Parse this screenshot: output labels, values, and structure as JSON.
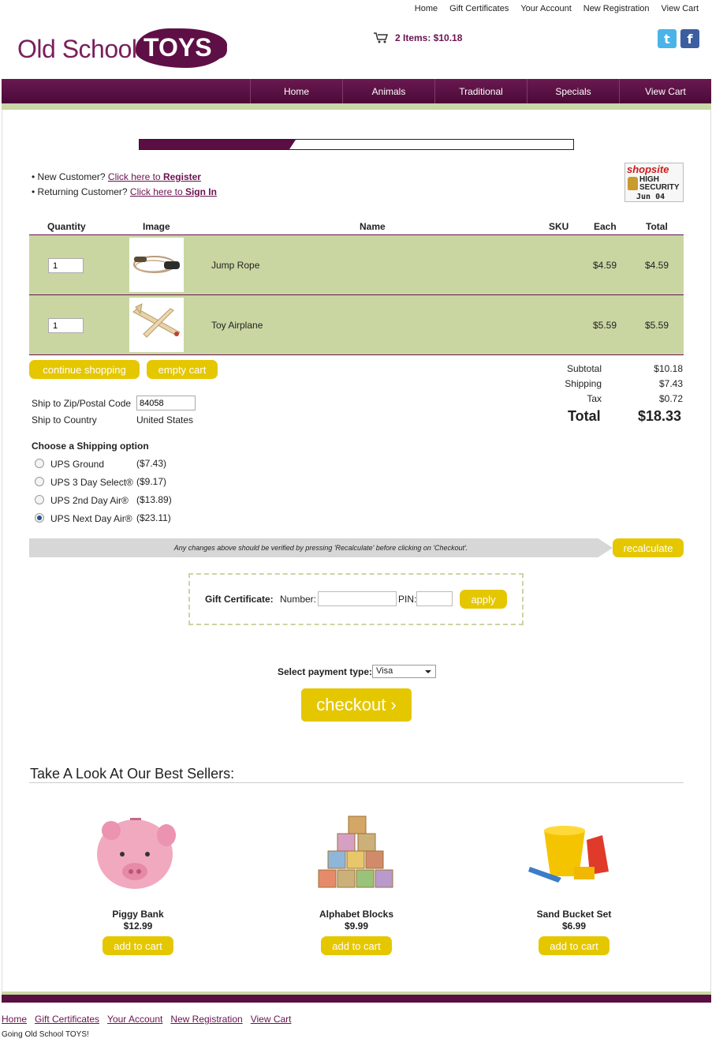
{
  "top_links": [
    "Home",
    "Gift Certificates",
    "Your Account",
    "New Registration",
    "View Cart"
  ],
  "logo": {
    "part1": "Old School",
    "part2": "TOYS"
  },
  "cart_summary": "2 Items: $10.18",
  "nav": [
    "Home",
    "Animals",
    "Traditional",
    "Specials",
    "View Cart"
  ],
  "checkout_progress": 0.36,
  "customer": {
    "new_prefix": "• New Customer? ",
    "new_link": "Click here to ",
    "new_link_bold": "Register",
    "ret_prefix": "• Returning Customer? ",
    "ret_link": "Click here to ",
    "ret_link_bold": "Sign In"
  },
  "badge": {
    "brand": "shopsite",
    "line1": "HIGH",
    "line2": "SECURITY",
    "date": "Jun 04"
  },
  "table": {
    "headers": {
      "quantity": "Quantity",
      "image": "Image",
      "name": "Name",
      "sku": "SKU",
      "each": "Each",
      "total": "Total"
    },
    "rows": [
      {
        "qty": "1",
        "name": "Jump Rope",
        "each": "$4.59",
        "total": "$4.59"
      },
      {
        "qty": "1",
        "name": "Toy Airplane",
        "each": "$5.59",
        "total": "$5.59"
      }
    ]
  },
  "buttons": {
    "continue": "continue shopping",
    "empty": "empty cart",
    "recalc": "recalculate",
    "apply": "apply",
    "checkout": "checkout ›",
    "add": "add to cart"
  },
  "totals": {
    "subtotal_label": "Subtotal",
    "subtotal": "$10.18",
    "shipping_label": "Shipping",
    "shipping": "$7.43",
    "tax_label": "Tax",
    "tax": "$0.72",
    "total_label": "Total",
    "total": "$18.33"
  },
  "ship": {
    "zip_label": "Ship to Zip/Postal Code",
    "zip": "84058",
    "country_label": "Ship to Country",
    "country": "United States"
  },
  "shipping_title": "Choose a Shipping option",
  "shipping_options": [
    {
      "label": "UPS Ground",
      "price": "($7.43)",
      "selected": false
    },
    {
      "label": "UPS 3 Day Select®",
      "price": "($9.17)",
      "selected": false
    },
    {
      "label": "UPS 2nd Day Air®",
      "price": "($13.89)",
      "selected": false
    },
    {
      "label": "UPS Next Day Air®",
      "price": "($23.11)",
      "selected": true
    }
  ],
  "recalc_note": "Any changes above should be verified by pressing 'Recalculate' before clicking on 'Checkout'.",
  "gift": {
    "label": "Gift Certificate:",
    "number_label": "Number:",
    "pin_label": "PIN:"
  },
  "payment": {
    "label": "Select payment type:",
    "value": "Visa"
  },
  "best_sellers_title": "Take A Look At Our Best Sellers:",
  "products": [
    {
      "name": "Piggy Bank",
      "price": "$12.99"
    },
    {
      "name": "Alphabet Blocks",
      "price": "$9.99"
    },
    {
      "name": "Sand Bucket Set",
      "price": "$6.99"
    }
  ],
  "footer_links": [
    "Home",
    "Gift Certificates",
    "Your Account",
    "New Registration",
    "View Cart"
  ],
  "footer_note": "Going Old School TOYS!",
  "colors": {
    "brand": "#5a0f43",
    "accent_green": "#c9d6a2",
    "button": "#e5c700"
  }
}
